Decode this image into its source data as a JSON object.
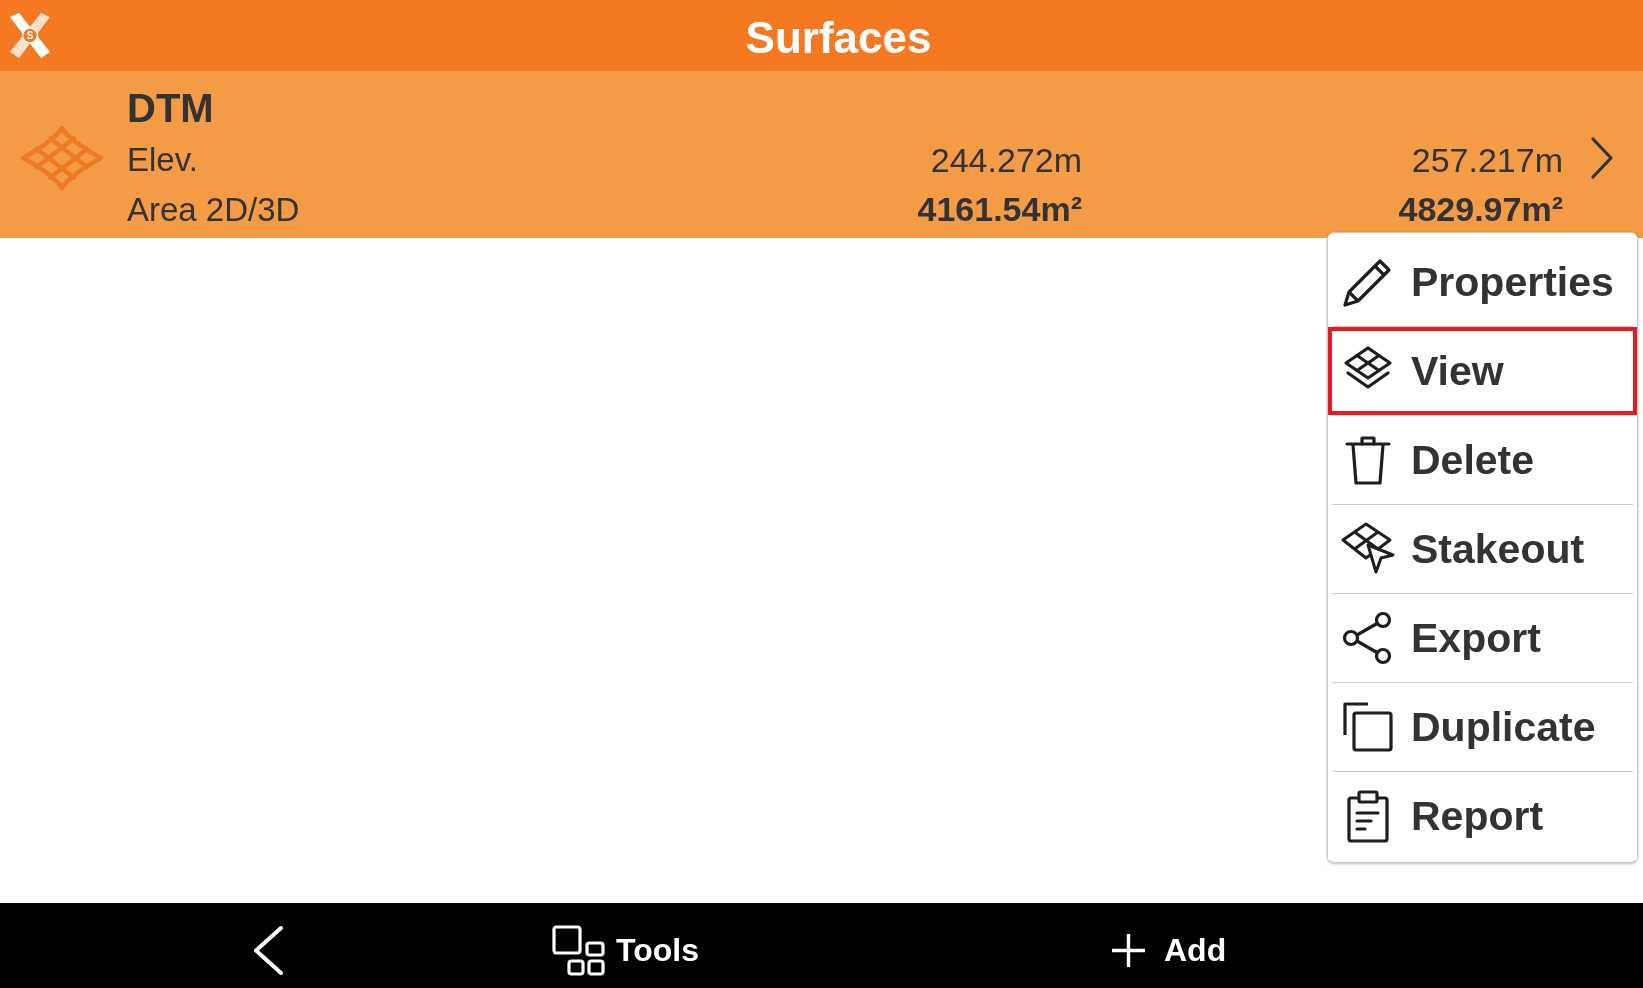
{
  "app_bar": {
    "logo_letter": "S",
    "title": "Surfaces"
  },
  "surfaces": [
    {
      "name": "DTM",
      "selected": true,
      "fields": [
        {
          "label": "Elev.",
          "value_1": "244.272m",
          "value_2": "257.217m",
          "values_bold": false
        },
        {
          "label": "Area 2D/3D",
          "value_1": "4161.54m²",
          "value_2": "4829.97m²",
          "values_bold": true
        }
      ]
    }
  ],
  "context_menu": {
    "items": [
      {
        "kind": "properties",
        "label": "Properties",
        "highlighted": false
      },
      {
        "kind": "view",
        "label": "View",
        "highlighted": true
      },
      {
        "kind": "delete",
        "label": "Delete",
        "highlighted": false
      },
      {
        "kind": "stakeout",
        "label": "Stakeout",
        "highlighted": false
      },
      {
        "kind": "export",
        "label": "Export",
        "highlighted": false
      },
      {
        "kind": "duplicate",
        "label": "Duplicate",
        "highlighted": false
      },
      {
        "kind": "report",
        "label": "Report",
        "highlighted": false
      }
    ]
  },
  "bottom_bar": {
    "buttons": [
      {
        "kind": "back"
      },
      {
        "kind": "tools",
        "label": "Tools"
      },
      {
        "kind": "add",
        "label": "Add"
      }
    ]
  }
}
